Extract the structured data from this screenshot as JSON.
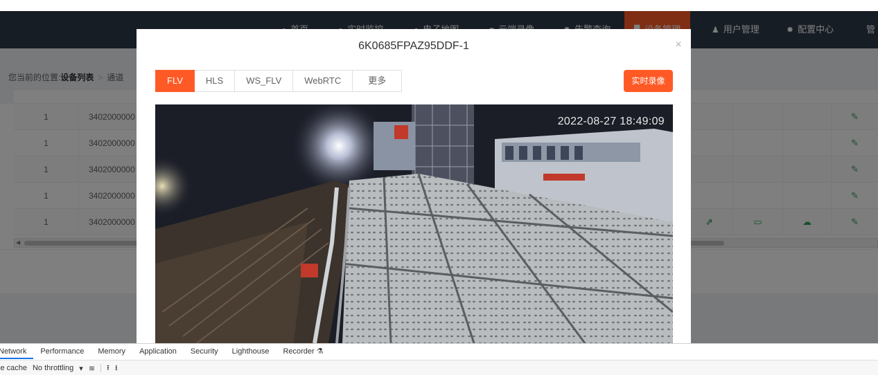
{
  "nav": {
    "items": [
      {
        "label": "首页",
        "icon": "home-icon",
        "glyph": "●"
      },
      {
        "label": "实时监控",
        "icon": "video-icon",
        "glyph": "●"
      },
      {
        "label": "电子地图",
        "icon": "map-pin-icon",
        "glyph": "●"
      },
      {
        "label": "云端录像",
        "icon": "camera-icon",
        "glyph": "■"
      },
      {
        "label": "告警查询",
        "icon": "alarm-icon",
        "glyph": "✹"
      },
      {
        "label": "设备管理",
        "icon": "device-icon",
        "glyph": "▉"
      },
      {
        "label": "用户管理",
        "icon": "user-icon",
        "glyph": "♟"
      },
      {
        "label": "配置中心",
        "icon": "gear-icon",
        "glyph": "✸"
      },
      {
        "label": "管",
        "icon": "",
        "glyph": ""
      }
    ],
    "active_index": 5
  },
  "breadcrumb": {
    "prefix": "您当前的位置:",
    "current": "设备列表",
    "sep": ">",
    "next": "通道"
  },
  "table": {
    "rows": [
      {
        "idx": "1",
        "id": "3402000000"
      },
      {
        "idx": "1",
        "id": "3402000000"
      },
      {
        "idx": "1",
        "id": "3402000000"
      },
      {
        "idx": "1",
        "id": "3402000000"
      },
      {
        "idx": "1",
        "id": "3402000000"
      }
    ],
    "edit_glyph": "✎",
    "share_glyph": "⇗",
    "record_glyph": "▭",
    "cloud_glyph": "☁"
  },
  "dialog": {
    "title": "6K0685FPAZ95DDF-1",
    "close": "×",
    "tabs": [
      "FLV",
      "HLS",
      "WS_FLV",
      "WebRTC",
      "更多"
    ],
    "active_tab": 0,
    "record_button": "实时录像",
    "timestamp": "2022-08-27 18:49:09"
  },
  "devtools": {
    "tabs": [
      "Network",
      "Performance",
      "Memory",
      "Application",
      "Security",
      "Lighthouse",
      "Recorder"
    ],
    "active_tab": 0,
    "recorder_glyph": "⚗",
    "toolbar": {
      "cache": "le cache",
      "throttling": "No throttling",
      "dropdown": "▾",
      "wifi": "≋",
      "upload": "⭱",
      "download": "⭳"
    }
  },
  "colors": {
    "accent": "#ff5a26",
    "navbar": "#2f3a4a",
    "icon_green": "#2f9d57"
  }
}
